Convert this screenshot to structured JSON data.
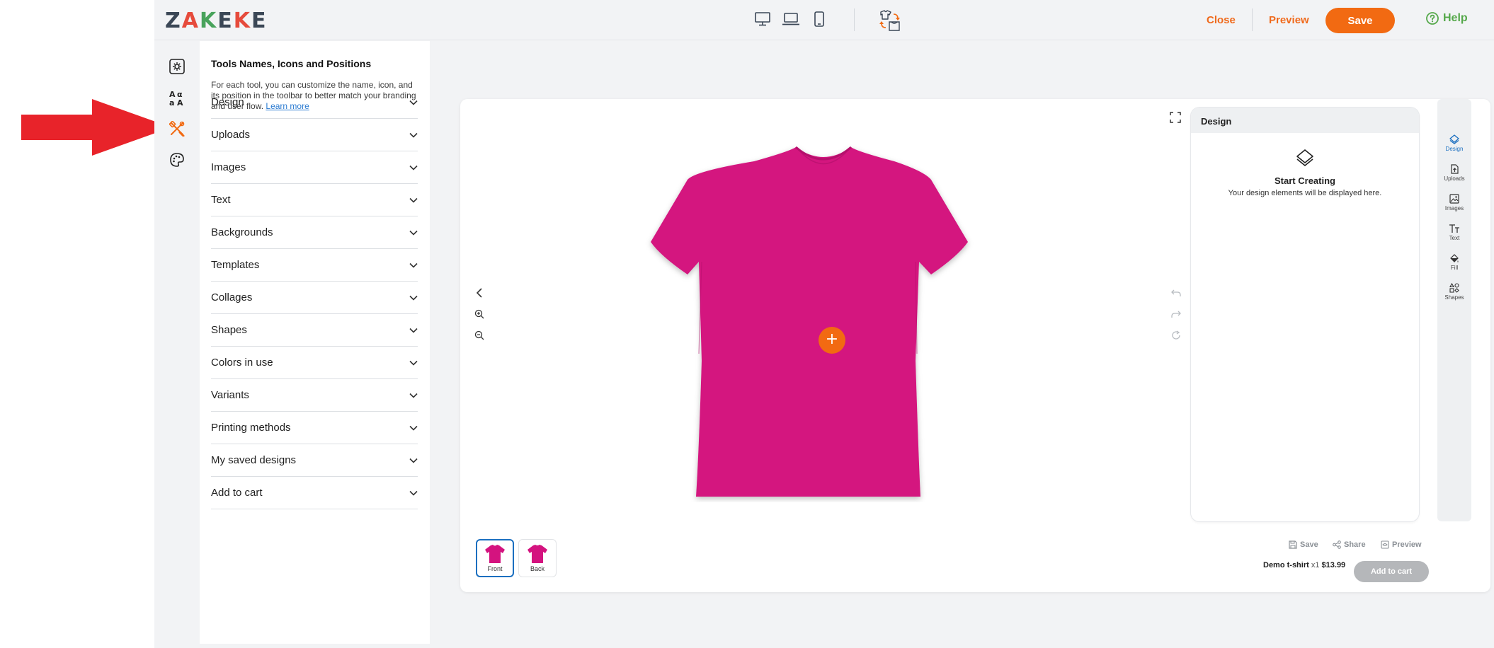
{
  "topbar": {
    "logo": {
      "z": "Z",
      "a": "A",
      "k1": "K",
      "e1": "E",
      "k2": "K",
      "e2": "E"
    },
    "devices": [
      "desktop-icon",
      "laptop-icon",
      "mobile-icon"
    ],
    "close_label": "Close",
    "preview_label": "Preview",
    "save_label": "Save",
    "help_label": "Help"
  },
  "rail": {
    "items": [
      "settings-icon",
      "translate-icon",
      "tools-icon",
      "palette-icon"
    ],
    "active_index": 2
  },
  "panel": {
    "title": "Tools Names, Icons and Positions",
    "description": "For each tool, you can customize the name, icon, and its position in the toolbar to better match your branding and user flow.",
    "learn_more": "Learn more",
    "sections": [
      {
        "label": "Design"
      },
      {
        "label": "Uploads"
      },
      {
        "label": "Images"
      },
      {
        "label": "Text"
      },
      {
        "label": "Backgrounds"
      },
      {
        "label": "Templates"
      },
      {
        "label": "Collages"
      },
      {
        "label": "Shapes"
      },
      {
        "label": "Colors in use"
      },
      {
        "label": "Variants"
      },
      {
        "label": "Printing methods"
      },
      {
        "label": "My saved designs"
      },
      {
        "label": "Add to cart"
      }
    ]
  },
  "preview": {
    "product_color": "#d4137f",
    "add_symbol": "+",
    "sides": [
      {
        "label": "Front",
        "active": true
      },
      {
        "label": "Back",
        "active": false
      }
    ]
  },
  "design_panel": {
    "title": "Design",
    "empty_title": "Start Creating",
    "empty_subtitle": "Your design elements will be displayed here."
  },
  "tools": [
    {
      "label": "Design",
      "icon": "layers-icon",
      "active": true
    },
    {
      "label": "Uploads",
      "icon": "upload-icon",
      "active": false
    },
    {
      "label": "Images",
      "icon": "image-icon",
      "active": false
    },
    {
      "label": "Text",
      "icon": "text-icon",
      "active": false
    },
    {
      "label": "Fill",
      "icon": "fill-icon",
      "active": false
    },
    {
      "label": "Shapes",
      "icon": "shapes-icon",
      "active": false
    }
  ],
  "footer": {
    "save_label": "Save",
    "share_label": "Share",
    "preview_label": "Preview",
    "product_name": "Demo t-shirt",
    "quantity": "x1",
    "price": "$13.99",
    "add_to_cart": "Add to cart"
  },
  "colors": {
    "accent": "#f26a12",
    "help": "#55a84a",
    "active_tool": "#1b6fc0",
    "annotation_arrow": "#e8232a"
  }
}
